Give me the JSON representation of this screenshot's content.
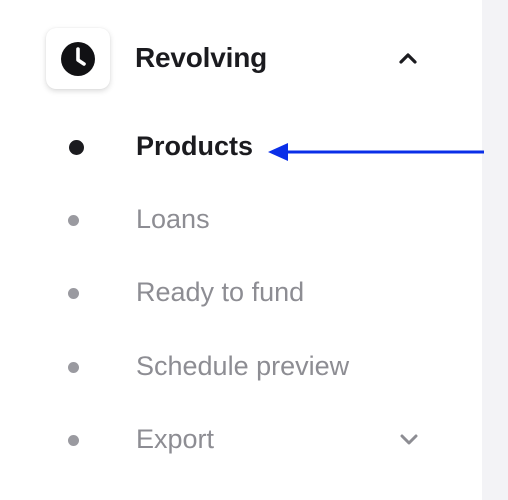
{
  "section": {
    "title": "Revolving",
    "icon": "clock-icon",
    "expanded": true
  },
  "nav": {
    "items": [
      {
        "label": "Products",
        "active": true
      },
      {
        "label": "Loans",
        "active": false
      },
      {
        "label": "Ready to fund",
        "active": false
      },
      {
        "label": "Schedule preview",
        "active": false
      },
      {
        "label": "Export",
        "active": false,
        "has_submenu": true
      }
    ]
  },
  "annotation": {
    "arrow_color": "#0a2fe8",
    "points_to": "Products"
  },
  "colors": {
    "active_text": "#1b1b1f",
    "inactive_text": "#8d8d93",
    "side_panel": "#f3f3f6"
  }
}
